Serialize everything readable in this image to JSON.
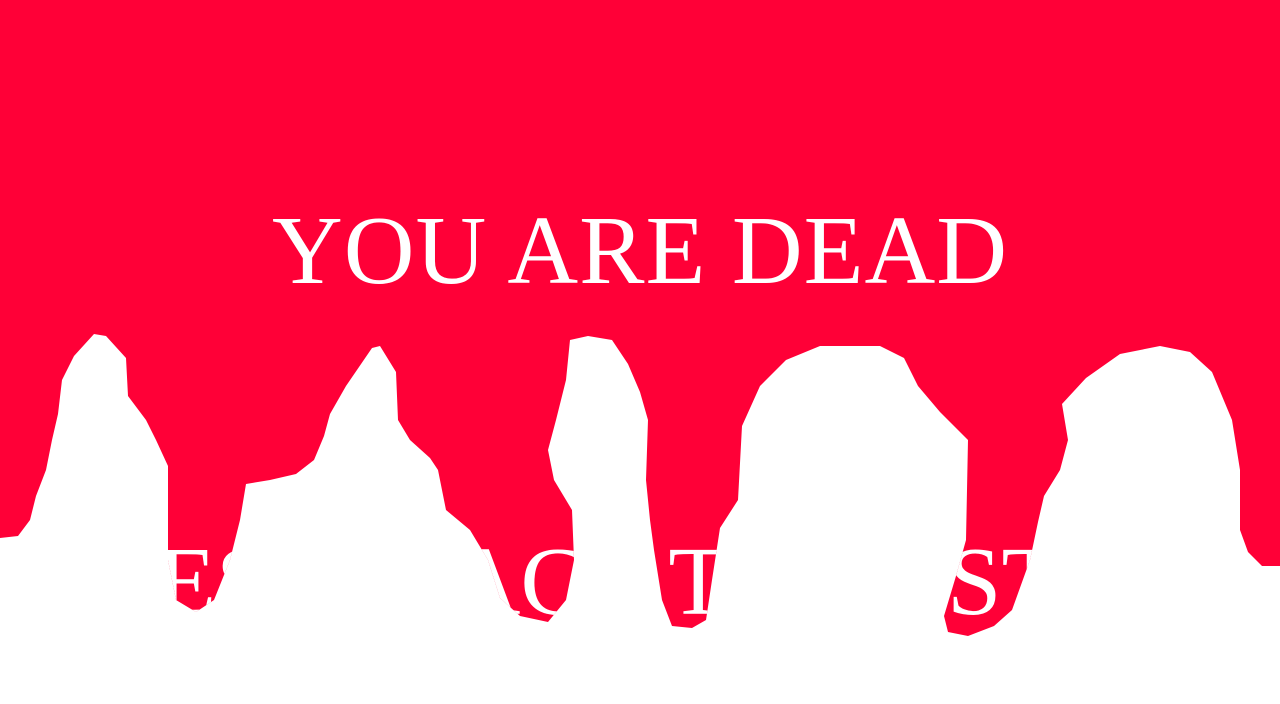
{
  "game_over": {
    "title": "YOU ARE DEAD",
    "prompt": "PRESS SPACE TO RESTART"
  },
  "colors": {
    "blood": "#ff0037",
    "background": "#ffffff",
    "text": "#ffffff"
  }
}
